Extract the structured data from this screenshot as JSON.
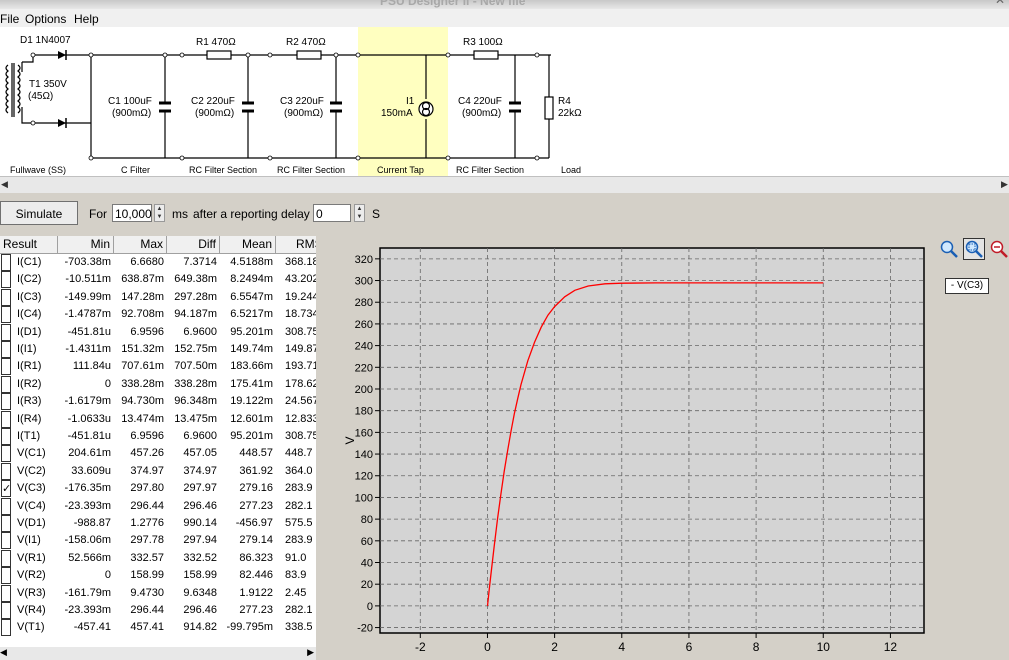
{
  "window": {
    "title": "PSU Designer II - New file"
  },
  "menu": [
    "File",
    "Options",
    "Help"
  ],
  "schematic": {
    "components": {
      "d1": "D1 1N4007",
      "t1_name": "T1 350V",
      "t1_res": "(45Ω)",
      "r1": "R1 470Ω",
      "r2": "R2 470Ω",
      "r3": "R3 100Ω",
      "c1_name": "C1 100uF",
      "c1_esr": "(900mΩ)",
      "c2_name": "C2 220uF",
      "c2_esr": "(900mΩ)",
      "c3_name": "C3 220uF",
      "c3_esr": "(900mΩ)",
      "c4_name": "C4 220uF",
      "c4_esr": "(900mΩ)",
      "i1_name": "I1",
      "i1_val": "150mA",
      "r4_name": "R4",
      "r4_val": "22kΩ"
    },
    "sections": [
      "Fullwave (SS)",
      "C Filter",
      "RC Filter Section",
      "RC Filter Section",
      "Current Tap",
      "RC Filter Section",
      "Load"
    ],
    "highlight_color": "#ffffc0"
  },
  "toolbar": {
    "simulate_label": "Simulate",
    "for_label": "For",
    "duration_value": "10,000",
    "ms_label": "ms",
    "delay_label": "after a reporting delay of",
    "delay_value": "0",
    "s_label": "S"
  },
  "results": {
    "headers": [
      "Result",
      "Min",
      "Max",
      "Diff",
      "Mean",
      "RMS"
    ],
    "rows": [
      {
        "name": "I(C1)",
        "min": "-703.38m",
        "max": "6.6680",
        "diff": "7.3714",
        "mean": "4.5188m",
        "rms": "368.18",
        "checked": false
      },
      {
        "name": "I(C2)",
        "min": "-10.511m",
        "max": "638.87m",
        "diff": "649.38m",
        "mean": "8.2494m",
        "rms": "43.202",
        "checked": false
      },
      {
        "name": "I(C3)",
        "min": "-149.99m",
        "max": "147.28m",
        "diff": "297.28m",
        "mean": "6.5547m",
        "rms": "19.244",
        "checked": false
      },
      {
        "name": "I(C4)",
        "min": "-1.4787m",
        "max": "92.708m",
        "diff": "94.187m",
        "mean": "6.5217m",
        "rms": "18.734",
        "checked": false
      },
      {
        "name": "I(D1)",
        "min": "-451.81u",
        "max": "6.9596",
        "diff": "6.9600",
        "mean": "95.201m",
        "rms": "308.75",
        "checked": false
      },
      {
        "name": "I(I1)",
        "min": "-1.4311m",
        "max": "151.32m",
        "diff": "152.75m",
        "mean": "149.74m",
        "rms": "149.87",
        "checked": false
      },
      {
        "name": "I(R1)",
        "min": "111.84u",
        "max": "707.61m",
        "diff": "707.50m",
        "mean": "183.66m",
        "rms": "193.71",
        "checked": false
      },
      {
        "name": "I(R2)",
        "min": "0",
        "max": "338.28m",
        "diff": "338.28m",
        "mean": "175.41m",
        "rms": "178.62",
        "checked": false
      },
      {
        "name": "I(R3)",
        "min": "-1.6179m",
        "max": "94.730m",
        "diff": "96.348m",
        "mean": "19.122m",
        "rms": "24.567",
        "checked": false
      },
      {
        "name": "I(R4)",
        "min": "-1.0633u",
        "max": "13.474m",
        "diff": "13.475m",
        "mean": "12.601m",
        "rms": "12.833",
        "checked": false
      },
      {
        "name": "I(T1)",
        "min": "-451.81u",
        "max": "6.9596",
        "diff": "6.9600",
        "mean": "95.201m",
        "rms": "308.75",
        "checked": false
      },
      {
        "name": "V(C1)",
        "min": "204.61m",
        "max": "457.26",
        "diff": "457.05",
        "mean": "448.57",
        "rms": "448.7",
        "checked": false
      },
      {
        "name": "V(C2)",
        "min": "33.609u",
        "max": "374.97",
        "diff": "374.97",
        "mean": "361.92",
        "rms": "364.0",
        "checked": false
      },
      {
        "name": "V(C3)",
        "min": "-176.35m",
        "max": "297.80",
        "diff": "297.97",
        "mean": "279.16",
        "rms": "283.9",
        "checked": true
      },
      {
        "name": "V(C4)",
        "min": "-23.393m",
        "max": "296.44",
        "diff": "296.46",
        "mean": "277.23",
        "rms": "282.1",
        "checked": false
      },
      {
        "name": "V(D1)",
        "min": "-988.87",
        "max": "1.2776",
        "diff": "990.14",
        "mean": "-456.97",
        "rms": "575.5",
        "checked": false
      },
      {
        "name": "V(I1)",
        "min": "-158.06m",
        "max": "297.78",
        "diff": "297.94",
        "mean": "279.14",
        "rms": "283.9",
        "checked": false
      },
      {
        "name": "V(R1)",
        "min": "52.566m",
        "max": "332.57",
        "diff": "332.52",
        "mean": "86.323",
        "rms": "91.0",
        "checked": false
      },
      {
        "name": "V(R2)",
        "min": "0",
        "max": "158.99",
        "diff": "158.99",
        "mean": "82.446",
        "rms": "83.9",
        "checked": false
      },
      {
        "name": "V(R3)",
        "min": "-161.79m",
        "max": "9.4730",
        "diff": "9.6348",
        "mean": "1.9122",
        "rms": "2.45",
        "checked": false
      },
      {
        "name": "V(R4)",
        "min": "-23.393m",
        "max": "296.44",
        "diff": "296.46",
        "mean": "277.23",
        "rms": "282.1",
        "checked": false
      },
      {
        "name": "V(T1)",
        "min": "-457.41",
        "max": "457.41",
        "diff": "914.82",
        "mean": "-99.795m",
        "rms": "338.5",
        "checked": false
      }
    ]
  },
  "plot": {
    "zoom_icons": [
      "zoom-in-icon",
      "zoom-box-icon",
      "zoom-out-icon"
    ],
    "legend_label": "- V(C3)"
  },
  "chart_data": {
    "type": "line",
    "title": "",
    "xlabel": "",
    "ylabel": "V",
    "xlim": [
      -3.2,
      13.0
    ],
    "ylim": [
      -25,
      330
    ],
    "xticks": [
      -2,
      0,
      2,
      4,
      6,
      8,
      10,
      12
    ],
    "yticks": [
      -20,
      0,
      20,
      40,
      60,
      80,
      100,
      120,
      140,
      160,
      180,
      200,
      220,
      240,
      260,
      280,
      300,
      320
    ],
    "grid": true,
    "line_color": "#ff0000",
    "plot_bg": "#d4d4d4",
    "series": [
      {
        "name": "V(C3)",
        "x": [
          0,
          0.05,
          0.1,
          0.2,
          0.3,
          0.4,
          0.5,
          0.6,
          0.7,
          0.8,
          0.9,
          1.0,
          1.2,
          1.4,
          1.6,
          1.8,
          2.0,
          2.3,
          2.6,
          3.0,
          3.5,
          4.0,
          5.0,
          6.0,
          8.0,
          10.0
        ],
        "y": [
          0,
          14,
          28,
          55,
          80,
          103,
          124,
          143,
          161,
          177,
          191,
          204,
          226,
          243,
          257,
          268,
          276,
          285,
          291,
          295,
          297,
          297.5,
          297.8,
          297.8,
          297.8,
          297.8
        ]
      }
    ]
  }
}
